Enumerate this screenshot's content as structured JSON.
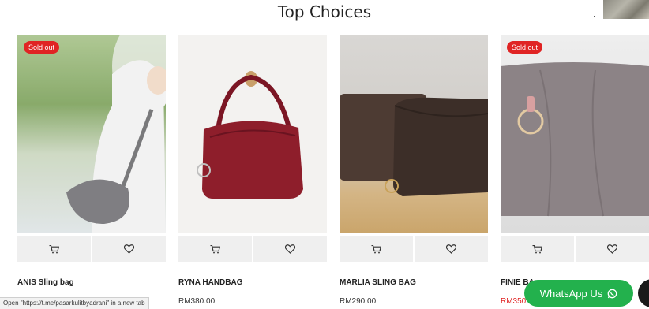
{
  "section": {
    "title": "Top Choices"
  },
  "products": [
    {
      "name": "ANIS Sling bag",
      "price": "",
      "badge": "Sold out"
    },
    {
      "name": "RYNA HANDBAG",
      "price": "RM380.00",
      "badge": ""
    },
    {
      "name": "MARLIA SLING BAG",
      "price": "RM290.00",
      "badge": ""
    },
    {
      "name": "FINIE BA",
      "price": "RM350",
      "badge": "Sold out"
    }
  ],
  "status_bar": {
    "text": "Open \"https://t.me/pasarkulitbyadrani\" in a new tab"
  },
  "whatsapp": {
    "label": "WhatsApp Us"
  },
  "colors": {
    "sold_out_badge": "#e02424",
    "whatsapp": "#23b14d",
    "button_bg": "#efefef"
  },
  "icons": [
    "cart-icon",
    "heart-icon",
    "whatsapp-icon"
  ]
}
